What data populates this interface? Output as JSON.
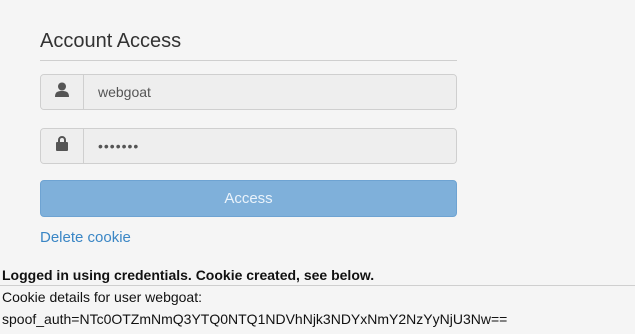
{
  "form": {
    "title": "Account Access",
    "username_value": "webgoat",
    "password_value": "•••••••",
    "submit_label": "Access",
    "delete_cookie_label": "Delete cookie"
  },
  "output": {
    "message": "Logged in using credentials. Cookie created, see below.",
    "details_label": "Cookie details for user webgoat:",
    "cookie_value": "spoof_auth=NTc0OTZmNmQ3YTQ0NTQ1NDVhNjk3NDYxNmY2NzYyNjU3Nw=="
  },
  "icons": {
    "user": "user-icon",
    "lock": "lock-icon"
  }
}
